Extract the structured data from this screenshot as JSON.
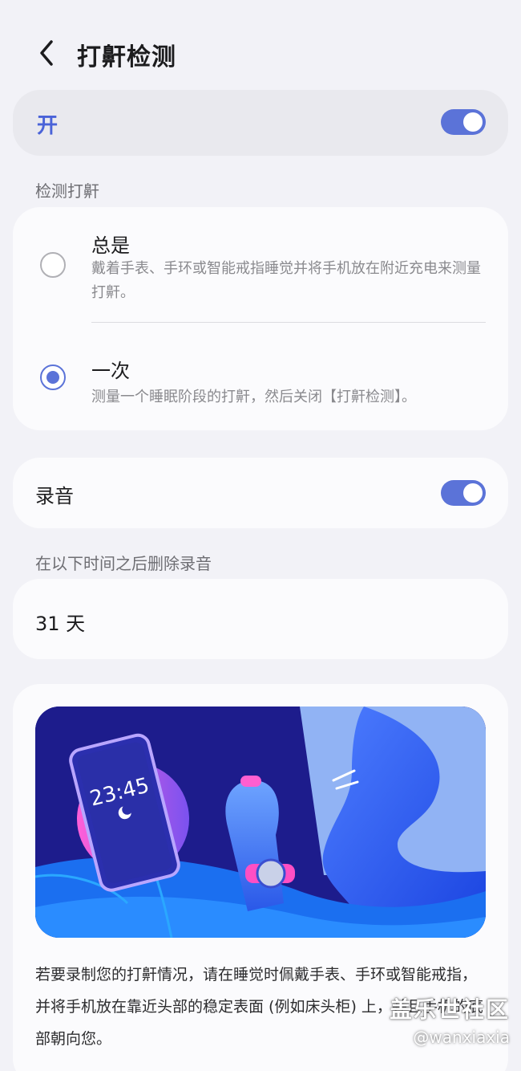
{
  "header": {
    "title": "打鼾检测",
    "back_icon": "chevron-left-icon"
  },
  "master": {
    "label": "开",
    "enabled": true
  },
  "detect": {
    "section_label": "检测打鼾",
    "options": [
      {
        "title": "总是",
        "description": "戴着手表、手环或智能戒指睡觉并将手机放在附近充电来测量打鼾。",
        "selected": false
      },
      {
        "title": "一次",
        "description": "测量一个睡眠阶段的打鼾，然后关闭【打鼾检测】。",
        "selected": true
      }
    ]
  },
  "recording": {
    "label": "录音",
    "enabled": true
  },
  "delete_after": {
    "section_label": "在以下时间之后删除录音",
    "value": "31 天"
  },
  "info": {
    "illustration_time": "23:45",
    "text": "若要录制您的打鼾情况，请在睡觉时佩戴手表、手环或智能戒指，并将手机放在靠近头部的稳定表面 (例如床头柜) 上，并且手机的底部朝向您。"
  },
  "watermark": {
    "main": "盖乐世社区",
    "sub": "@wanxiaxia"
  },
  "colors": {
    "accent": "#5b73d8",
    "background": "#f2f2f7",
    "illustration_bg": "#1d1c8c"
  }
}
